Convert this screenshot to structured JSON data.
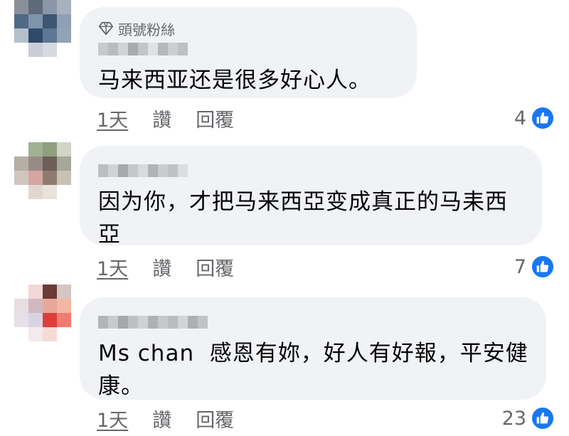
{
  "comments": [
    {
      "badge": "頭號粉絲",
      "text": "马来西亚还是很多好心人。",
      "time": "1天",
      "like_action": "讚",
      "reply_action": "回覆",
      "like_count": "4"
    },
    {
      "text": "因为你，才把马来西亞变成真正的马耒西亞",
      "time": "1天",
      "like_action": "讚",
      "reply_action": "回覆",
      "like_count": "7"
    },
    {
      "text": "Ms chan  感恩有妳，好人有好報，平安健康。",
      "time": "1天",
      "like_action": "讚",
      "reply_action": "回覆",
      "like_count": "23"
    }
  ],
  "icons": {
    "badge": "diamond-icon",
    "reaction": "thumbs-up-icon"
  },
  "colors": {
    "bubble": "#f0f2f5",
    "secondary_text": "#65676b",
    "like_blue": "#1877f2"
  }
}
